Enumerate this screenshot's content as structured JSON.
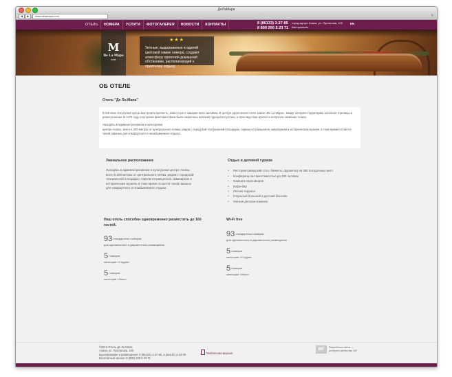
{
  "browser": {
    "window_title": "ДеЛаМара",
    "url": "www.delamara.com",
    "back_label": "◀",
    "forward_label": "▶",
    "reload_label": "↻"
  },
  "nav": {
    "items": [
      {
        "label": "ОТЕЛЬ",
        "active": true
      },
      {
        "label": "НОМЕРА"
      },
      {
        "label": "УСЛУГИ"
      },
      {
        "label": "ФОТОГАЛЕРЕЯ"
      },
      {
        "label": "НОВОСТИ"
      },
      {
        "label": "КОНТАКТЫ"
      }
    ],
    "phone1": "8 (86133) 3-27-85",
    "phone2": "8 800 200 5 23 71",
    "address_line1": "город-курорт Анапа, ул. Протапова, 102",
    "address_line2": "Как проехать",
    "language": "EN"
  },
  "hero": {
    "logo_glyph": "M",
    "logo_text": "De La Mapa",
    "logo_sub": "hotel",
    "stars": "★★★",
    "caption": "Уютные, выдержанные в единой цветовой гамме номера, создают атмосферу приятной домашней обстановки, располагающей к приятному отдыху."
  },
  "page": {
    "title": "ОБ ОТЕЛЕ",
    "subtitle": "Отель \"Де Ла Мапа\"",
    "intro_p1": "В XIII веке генуэзские купцы выстроили крепость, известную в средние века как Мапа. В центре укрепления стоял замок «De La Mapa», вокруг которого территорию заселили торговцы и ремесленники. В 1475 году генуэзская фактория Мапа была захвачена войском турецкого султана, и впоследствии крепость получила название Анапа.",
    "intro_p2a": "Находясь в административном и культурном",
    "intro_p2b": "центре Анапы, всего в 200 метрах от центрального пляжа, рядом с городской театральной площадью, парком аттракционов, аквапарком и историческим музеем, в тоже время остается тихой гаванью для комфортного и незабываемого отдыха."
  },
  "features": {
    "left_title": "Уникальное расположение",
    "left_text": "Находясь в административном и культурном центре Анапы, всего в 200 метрах от центрального пляжа, рядом с городской театральной площадью, парком аттракционов, аквапарком и историческим музеем, в тоже время остается тихой гаванью для комфортного и незабываемого отдыха.",
    "right_title": "Отдых и деловой туризм",
    "right_items": [
      "Ресторан (шведский стол, банкеты, фуршеты) на 350 посадочных мест",
      "Конференц-зал вместимостью до 100 человек",
      "Комната переговоров",
      "Кафе-бар",
      "Летняя терраса",
      "Открытый большой и детский бассейн",
      "Уютная детская комната"
    ]
  },
  "capacity": {
    "left_title": "Наш отель способен одновременно разместить до 160 гостей.",
    "right_title": "Wi-Fi free",
    "left_stats": [
      {
        "num": "93",
        "unit": "стандартных номеров",
        "desc": "для одноместного и двухместного размещения"
      },
      {
        "num": "5",
        "unit": "номеров",
        "desc": "категории «Студия»"
      },
      {
        "num": "5",
        "unit": "номеров",
        "desc": "категории «Люкс»"
      }
    ],
    "right_stats": [
      {
        "num": "93",
        "unit": "стандартных номеров",
        "desc": "для одноместного и двухместного размещения"
      },
      {
        "num": "5",
        "unit": "номеров",
        "desc": "категории «Студия»"
      },
      {
        "num": "5",
        "unit": "номеров",
        "desc": "категории «Люкс»"
      }
    ]
  },
  "footer": {
    "copyright": "©2013 Отель Де Ла Мапа",
    "address": "Анапа, ул. Протапова, 102",
    "booking": "Бронирование и размещение:  8 (86133) 3-27-85,  8 (86133) 3-03-09",
    "free_call": "Бесплатный звонок:  8 (800) 200 5 23 71",
    "mobile_label": "Мобильная версия",
    "dev_logo": "WF",
    "dev_text1": "Разработка сайта —",
    "dev_text2": "интернет-агентство WF"
  },
  "colors": {
    "brand": "#6c1d4b",
    "page_bg": "#f1f1f1"
  }
}
